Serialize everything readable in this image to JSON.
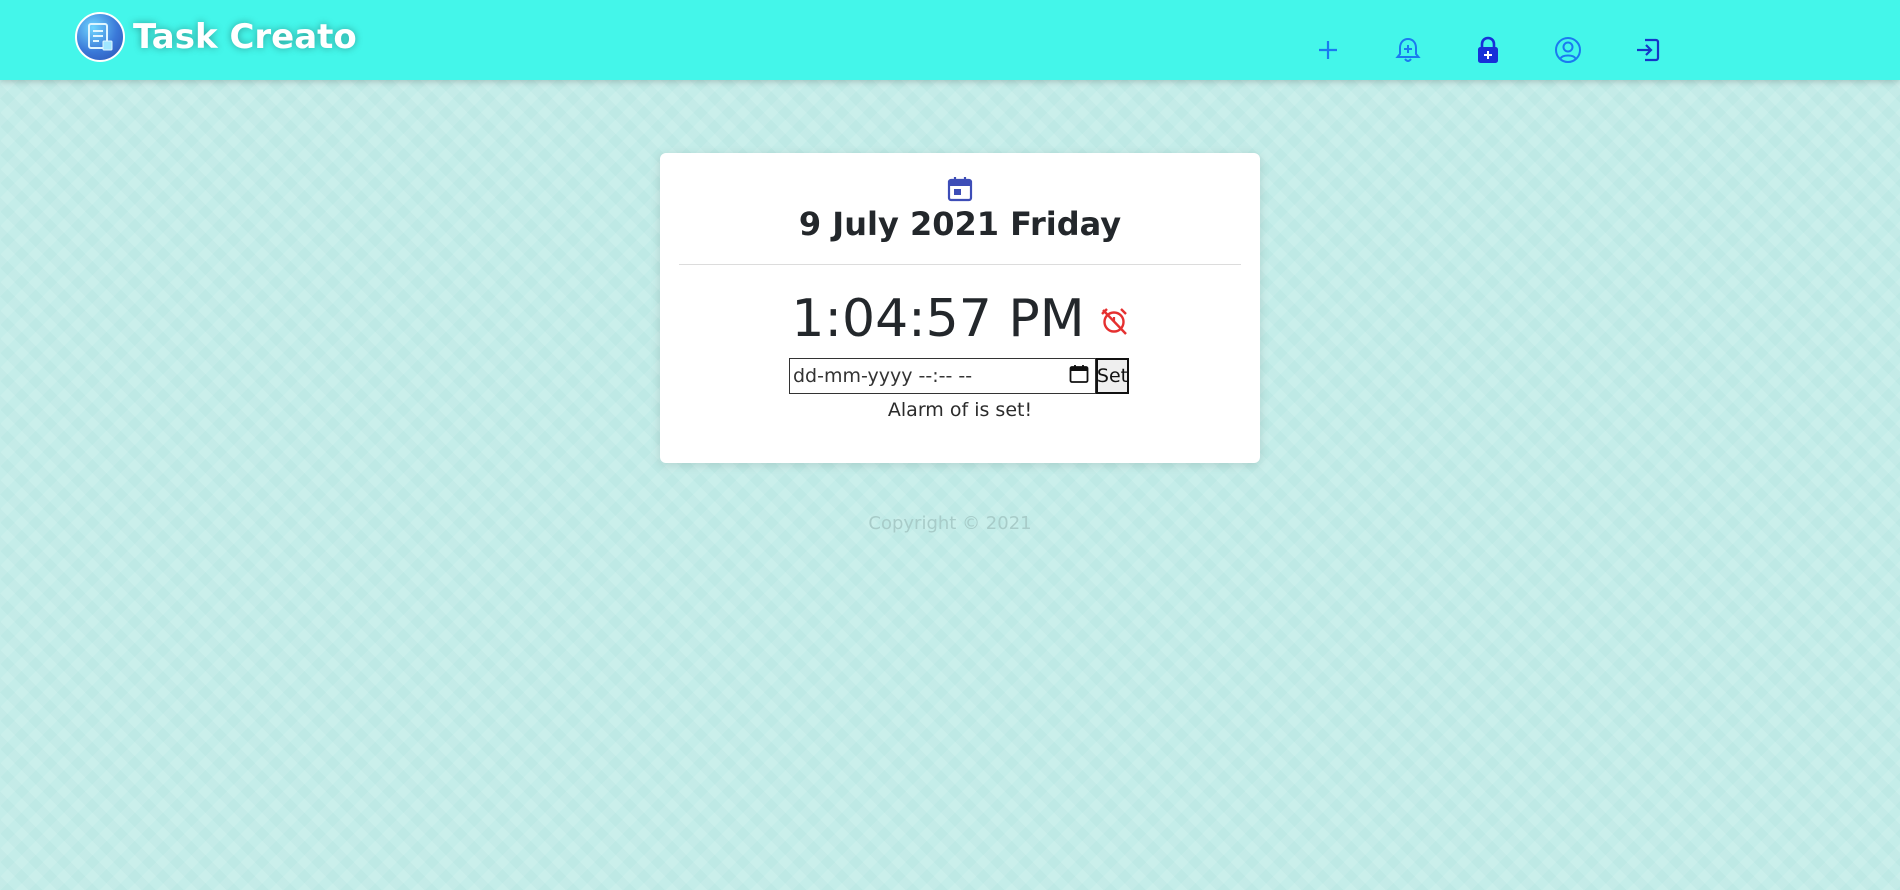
{
  "app": {
    "brand_name": "Task Creato"
  },
  "nav": {
    "items": [
      {
        "name": "add-task",
        "icon": "plus-icon"
      },
      {
        "name": "add-reminder",
        "icon": "bell-plus-icon"
      },
      {
        "name": "lock",
        "icon": "lock-plus-icon"
      },
      {
        "name": "profile",
        "icon": "user-circle-icon"
      },
      {
        "name": "logout",
        "icon": "sign-out-icon"
      }
    ],
    "icon_color": "#1a7af0"
  },
  "card": {
    "date": "9 July 2021 Friday",
    "time": "1:04:57 PM",
    "alarm_input": {
      "placeholder": "dd-mm-yyyy  --:-- --"
    },
    "set_label": "Set",
    "alarm_status": "Alarm of is set!"
  },
  "footer": {
    "copyright": "Copyright © 2021"
  },
  "colors": {
    "navbar": "#44f6ea",
    "background": "#c4ede9",
    "alarm_icon": "#e53030",
    "calendar_icon": "#3d4db7"
  }
}
